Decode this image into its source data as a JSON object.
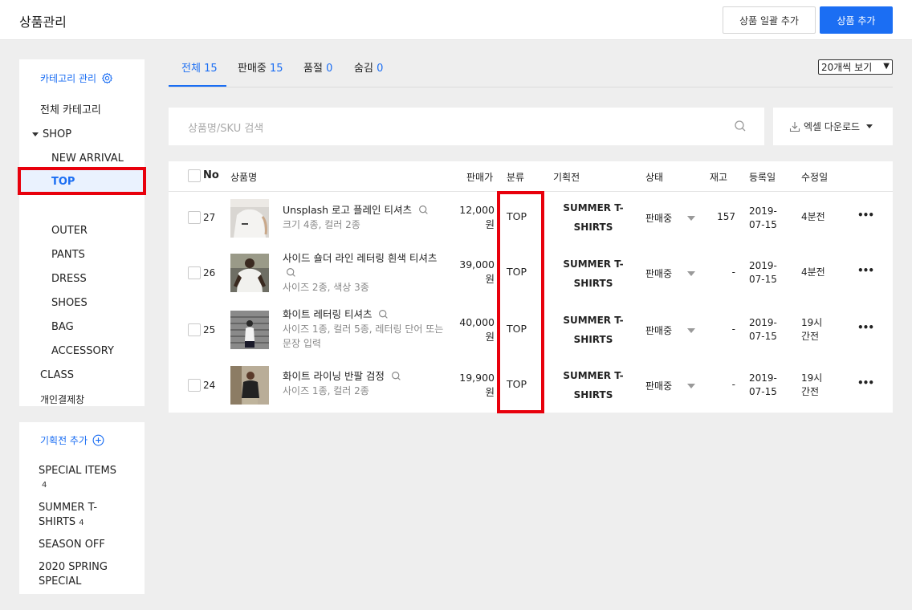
{
  "header": {
    "title": "상품관리",
    "bulk_add": "상품 일괄 추가",
    "add": "상품 추가"
  },
  "category_panel": {
    "title": "카테고리 관리",
    "all": "전체 카테고리",
    "shop": "SHOP",
    "items": [
      "NEW ARRIVAL",
      "TOP",
      "OUTER",
      "PANTS",
      "DRESS",
      "SHOES",
      "BAG",
      "ACCESSORY"
    ],
    "selected": "TOP",
    "class": "CLASS",
    "personal": "개인결제창"
  },
  "plan_panel": {
    "title": "기획전 추가",
    "items": [
      {
        "name": "SPECIAL ITEMS",
        "count": "4"
      },
      {
        "name_line1": "SUMMER T-",
        "name_line2": "SHIRTS",
        "count": "4"
      },
      {
        "name": "SEASON OFF"
      },
      {
        "name_line1": "2020 SPRING",
        "name_line2": "SPECIAL"
      }
    ]
  },
  "tabs": [
    {
      "label": "전체",
      "count": "15",
      "active": true
    },
    {
      "label": "판매중",
      "count": "15"
    },
    {
      "label": "품절",
      "count": "0"
    },
    {
      "label": "숨김",
      "count": "0"
    }
  ],
  "per_page": "20개씩 보기",
  "search": {
    "placeholder": "상품명/SKU 검색"
  },
  "excel": {
    "label": "엑셀 다운로드"
  },
  "table": {
    "headers": {
      "no": "No",
      "name": "상품명",
      "price": "판매가",
      "category": "분류",
      "plan": "기획전",
      "status": "상태",
      "stock": "재고",
      "registered": "등록일",
      "modified": "수정일"
    },
    "rows": [
      {
        "no": "27",
        "name_line1": "Unsplash 로고 플레인 티셔츠",
        "sub1": "크기 4종, 컬러 2종",
        "price1": "12,000",
        "price2": "원",
        "category": "TOP",
        "plan1": "SUMMER T-",
        "plan2": "SHIRTS",
        "status": "판매중",
        "stock": "157",
        "reg1": "2019-",
        "reg2": "07-15",
        "mod1": "4분전",
        "mod2": ""
      },
      {
        "no": "26",
        "name_line1": "사이드 숄더 라인 레터링 흰색 티셔츠",
        "sub1": "사이즈 2종, 색상 3종",
        "price1": "39,000",
        "price2": "원",
        "category": "TOP",
        "plan1": "SUMMER T-",
        "plan2": "SHIRTS",
        "status": "판매중",
        "stock": "-",
        "reg1": "2019-",
        "reg2": "07-15",
        "mod1": "4분전",
        "mod2": ""
      },
      {
        "no": "25",
        "name_line1": "화이트 레터링 티셔츠",
        "sub1": "사이즈 1종, 컬러 5종, 레터링 단어 또는",
        "sub2": "문장 입력",
        "price1": "40,000",
        "price2": "원",
        "category": "TOP",
        "plan1": "SUMMER T-",
        "plan2": "SHIRTS",
        "status": "판매중",
        "stock": "-",
        "reg1": "2019-",
        "reg2": "07-15",
        "mod1": "19시",
        "mod2": "간전"
      },
      {
        "no": "24",
        "name_line1": "화이트 라이닝 반팔 검정",
        "sub1": "사이즈 1종, 컬러 2종",
        "price1": "19,900",
        "price2": "원",
        "category": "TOP",
        "plan1": "SUMMER T-",
        "plan2": "SHIRTS",
        "status": "판매중",
        "stock": "-",
        "reg1": "2019-",
        "reg2": "07-15",
        "mod1": "19시",
        "mod2": "간전"
      }
    ],
    "more": "•••"
  },
  "colors": {
    "accent": "#1b6ef3",
    "highlight": "#e8000c"
  },
  "icons": [
    "gear-icon",
    "plus-circle-icon",
    "search-icon",
    "download-icon",
    "caret-down-icon",
    "more-icon"
  ]
}
